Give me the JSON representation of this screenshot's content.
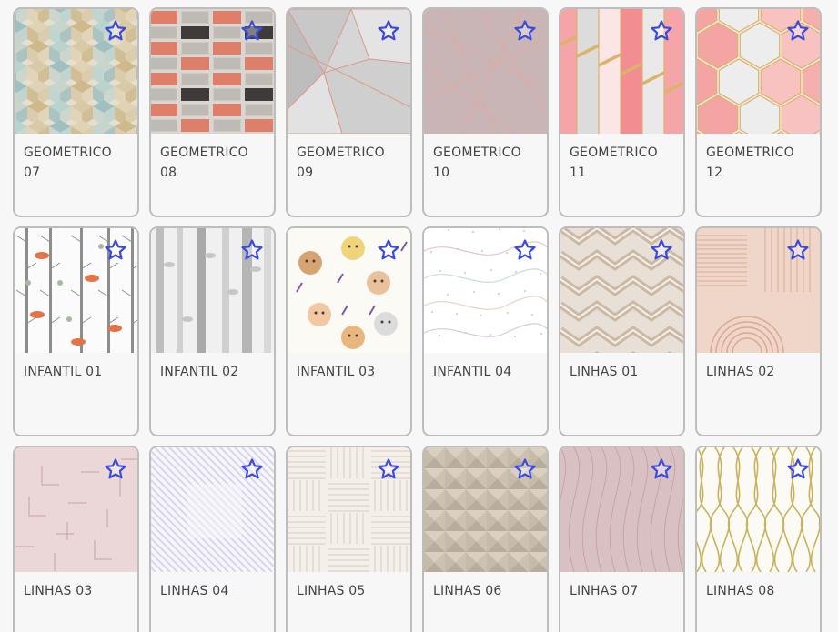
{
  "accent": "#3d4bd8",
  "products": [
    {
      "name": "GEOMETRICO 07",
      "pattern": "cubes"
    },
    {
      "name": "GEOMETRICO 08",
      "pattern": "weave"
    },
    {
      "name": "GEOMETRICO 09",
      "pattern": "facets-grey"
    },
    {
      "name": "GEOMETRICO 10",
      "pattern": "facets-mauve"
    },
    {
      "name": "GEOMETRICO 11",
      "pattern": "pink-blocks"
    },
    {
      "name": "GEOMETRICO 12",
      "pattern": "pink-hexagons"
    },
    {
      "name": "INFANTIL 01",
      "pattern": "forest-animals"
    },
    {
      "name": "INFANTIL 02",
      "pattern": "grey-trees"
    },
    {
      "name": "INFANTIL 03",
      "pattern": "baby-animals"
    },
    {
      "name": "INFANTIL 04",
      "pattern": "hearts-lines"
    },
    {
      "name": "LINHAS 01",
      "pattern": "beige-zigzag"
    },
    {
      "name": "LINHAS 02",
      "pattern": "peach-arches"
    },
    {
      "name": "LINHAS 03",
      "pattern": "pink-lines"
    },
    {
      "name": "LINHAS 04",
      "pattern": "lilac-diagonals"
    },
    {
      "name": "LINHAS 05",
      "pattern": "beige-stripes"
    },
    {
      "name": "LINHAS 06",
      "pattern": "taupe-pyramids"
    },
    {
      "name": "LINHAS 07",
      "pattern": "mauve-waves"
    },
    {
      "name": "LINHAS 08",
      "pattern": "gold-waves"
    }
  ]
}
